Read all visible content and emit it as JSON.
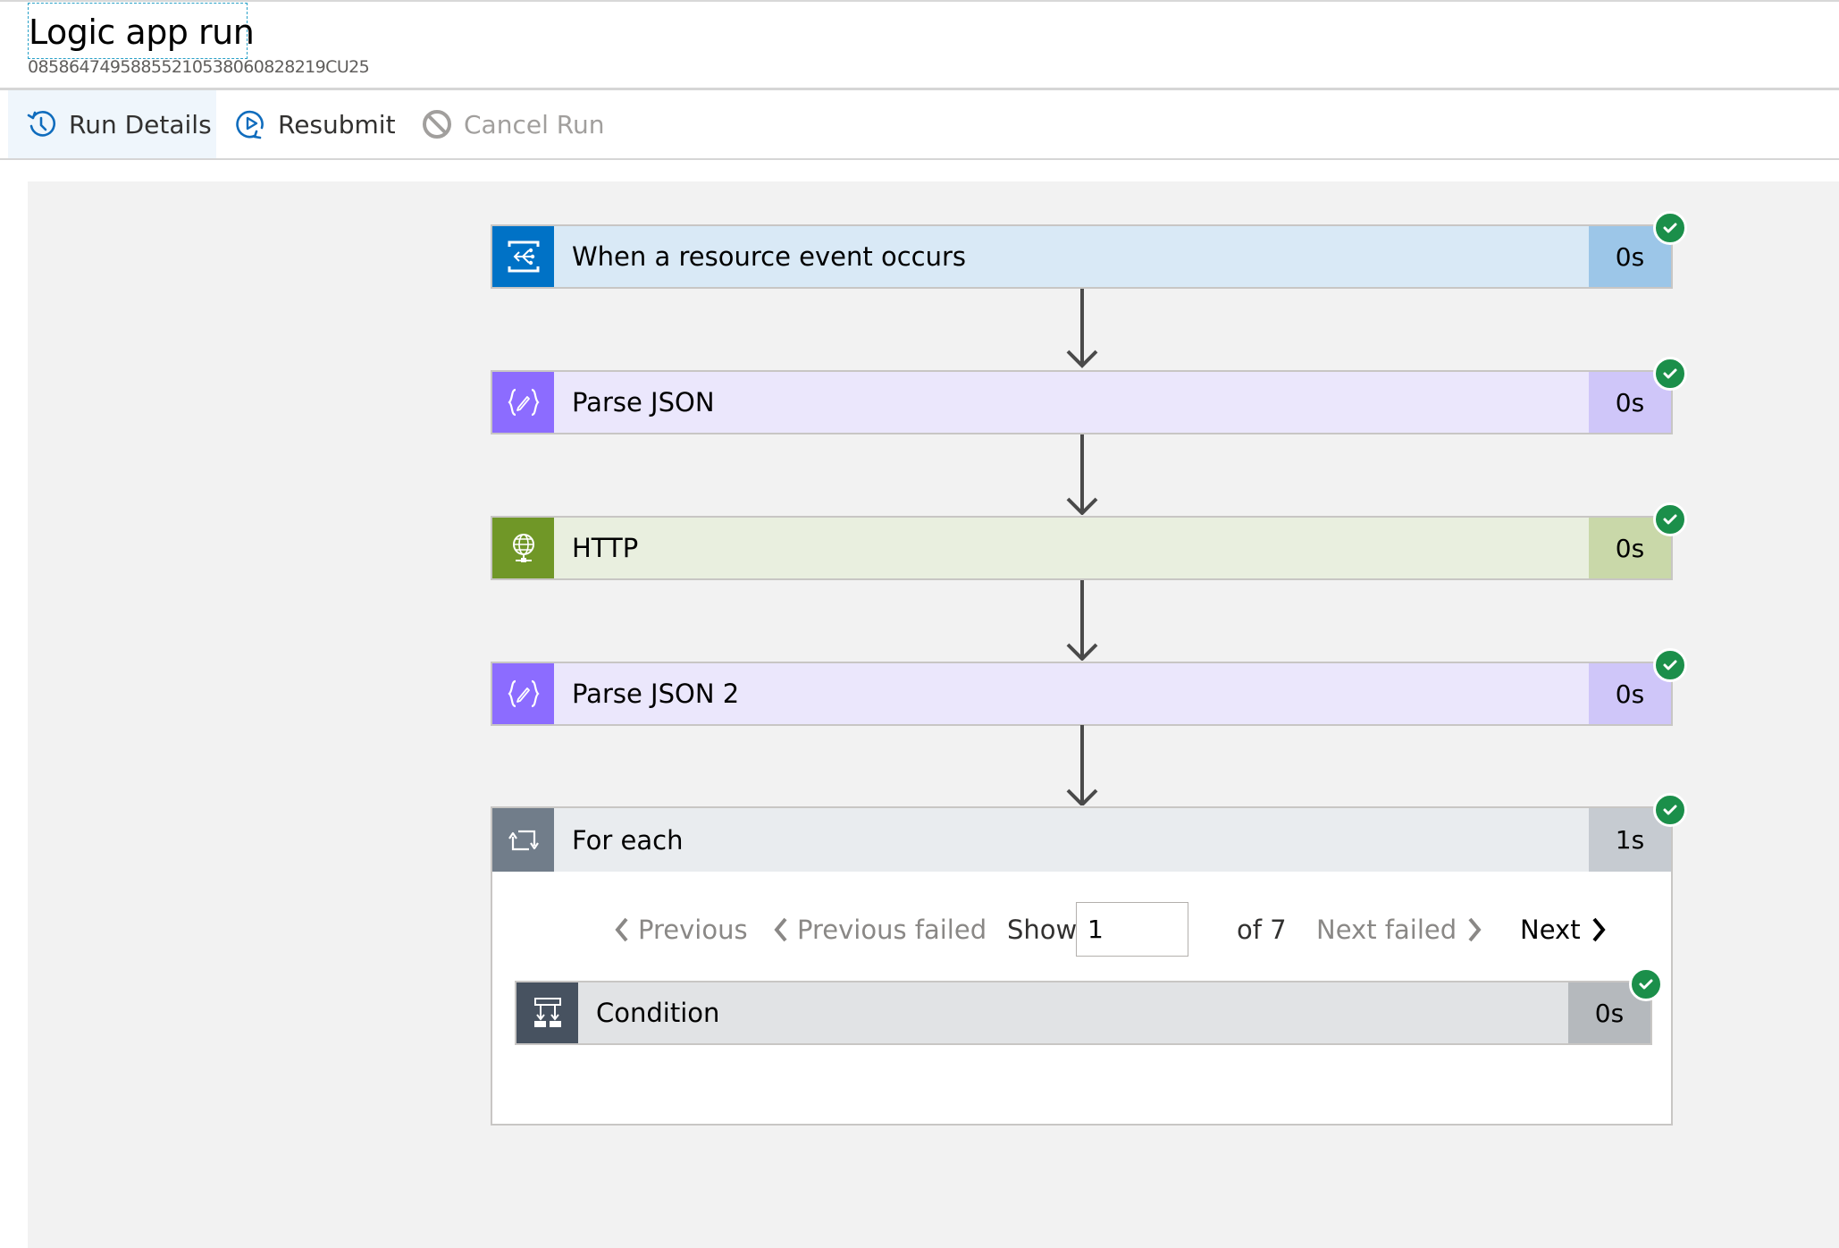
{
  "header": {
    "title": "Logic app run",
    "run_id": "08586474958855210538060828219CU25"
  },
  "toolbar": {
    "run_details_label": "Run Details",
    "resubmit_label": "Resubmit",
    "cancel_run_label": "Cancel Run"
  },
  "colors": {
    "accent": "#0f6cbd",
    "success": "#1b8f4a"
  },
  "steps": [
    {
      "label": "When a resource event occurs",
      "duration": "0s",
      "status": "succeeded",
      "icon": "event-grid-icon",
      "icon_bg": "#0072c6",
      "body_bg": "#d9e9f6",
      "duration_bg": "#9cc6e8"
    },
    {
      "label": "Parse JSON",
      "duration": "0s",
      "status": "succeeded",
      "icon": "parse-json-icon",
      "icon_bg": "#8c6cff",
      "body_bg": "#ebe7fc",
      "duration_bg": "#cfc6f9"
    },
    {
      "label": "HTTP",
      "duration": "0s",
      "status": "succeeded",
      "icon": "http-globe-icon",
      "icon_bg": "#709727",
      "body_bg": "#e9efdf",
      "duration_bg": "#c9d8a9"
    },
    {
      "label": "Parse JSON 2",
      "duration": "0s",
      "status": "succeeded",
      "icon": "parse-json-icon",
      "icon_bg": "#8c6cff",
      "body_bg": "#ebe7fc",
      "duration_bg": "#cfc6f9"
    }
  ],
  "foreach": {
    "label": "For each",
    "duration": "1s",
    "status": "succeeded",
    "icon": "loop-icon",
    "pager": {
      "previous_label": "Previous",
      "previous_failed_label": "Previous failed",
      "show_label": "Show",
      "current_value": "1",
      "of_label": "of 7",
      "next_failed_label": "Next failed",
      "next_label": "Next"
    },
    "condition": {
      "label": "Condition",
      "duration": "0s",
      "status": "succeeded",
      "icon": "condition-icon"
    }
  }
}
